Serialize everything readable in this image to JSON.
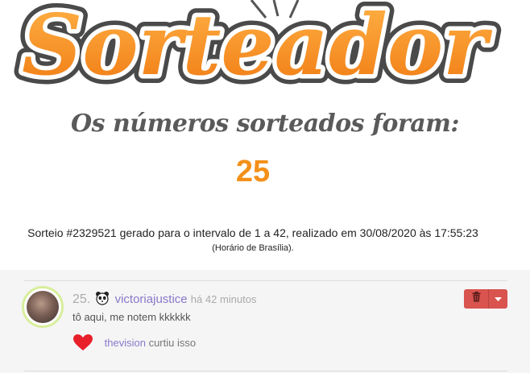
{
  "logo": {
    "text": "Sorteador"
  },
  "headline": "Os números sorteados foram:",
  "result": "25",
  "info": "Sorteio #2329521 gerado para o intervalo de 1 a 42, realizado em 30/08/2020 às 17:55:23",
  "timezone_note": "(Horário de Brasília).",
  "comment": {
    "number": "25.",
    "avatar_icon": "panda-icon",
    "username": "victoriajustice",
    "time": "há 42 minutos",
    "text": "tô aqui, me notem kkkkkk",
    "liked_by": "thevision",
    "liked_text": "curtiu isso",
    "actions": {
      "delete_icon": "trash-icon",
      "menu_icon": "caret-down-icon",
      "color": "#d9534f"
    }
  },
  "colors": {
    "accent": "#f39019",
    "username": "#8a79c9",
    "heart": "#e8202a"
  }
}
